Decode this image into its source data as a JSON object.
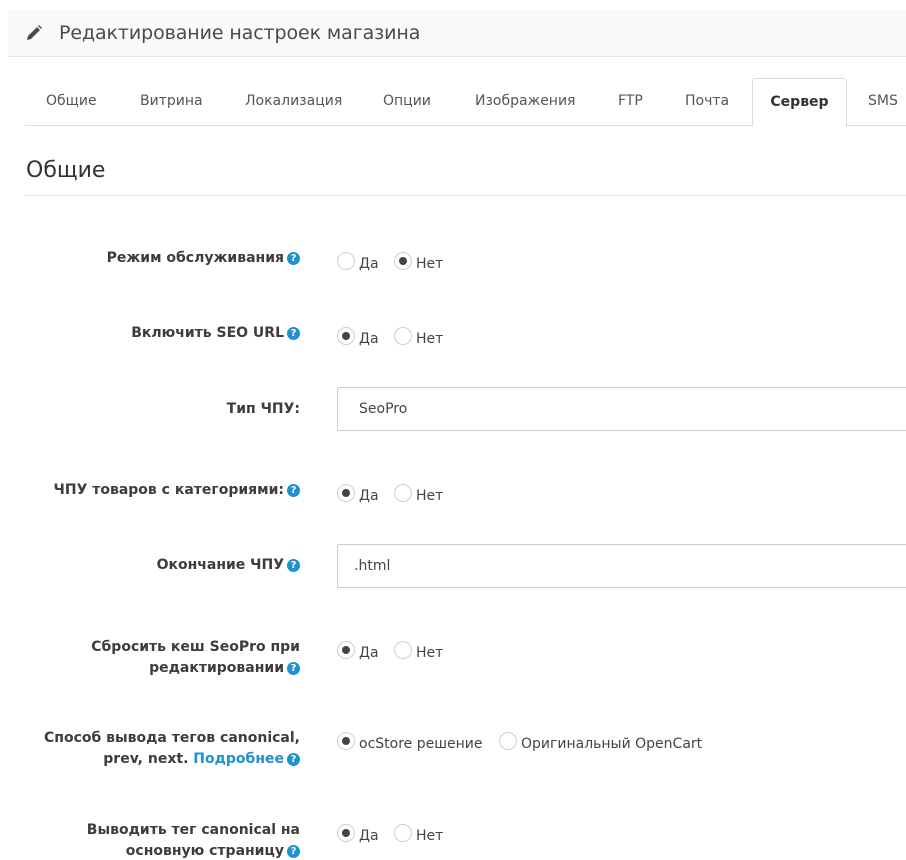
{
  "header": {
    "title": "Редактирование настроек магазина",
    "icon": "pencil-icon"
  },
  "tabs": [
    {
      "label": "Общие"
    },
    {
      "label": "Витрина"
    },
    {
      "label": "Локализация"
    },
    {
      "label": "Опции"
    },
    {
      "label": "Изображения"
    },
    {
      "label": "FTP"
    },
    {
      "label": "Почта"
    },
    {
      "label": "Сервер",
      "active": true
    },
    {
      "label": "SMS"
    }
  ],
  "section": {
    "title": "Общие"
  },
  "help_glyph": "?",
  "options": {
    "yes": "Да",
    "no": "Нет"
  },
  "fields": {
    "maintenance": {
      "label": "Режим обслуживания",
      "value": "Нет"
    },
    "seo_url": {
      "label": "Включить SEO URL",
      "value": "Да"
    },
    "seo_type": {
      "label": "Тип ЧПУ:",
      "value": "SeoPro"
    },
    "seo_categories": {
      "label": "ЧПУ товаров с категориями:",
      "value": "Да"
    },
    "seo_postfix": {
      "label": "Окончание ЧПУ",
      "value": ".html"
    },
    "reset_cache": {
      "label_line1": "Сбросить кеш SeoPro при",
      "label_line2": "редактировании",
      "value": "Да"
    },
    "canonical_method": {
      "label_line1": "Способ вывода тегов canonical,",
      "label_line2": "prev, next.",
      "link": "Подробнее",
      "option1": "ocStore решение",
      "option2": "Оригинальный OpenCart",
      "value": "ocStore решение"
    },
    "canonical_home": {
      "label_line1": "Выводить тег canonical на",
      "label_line2": "основную страницу",
      "value": "Да"
    }
  },
  "colors": {
    "accent": "#1e91cf",
    "border": "#dddddd",
    "heading_bg": "#fafafa"
  }
}
